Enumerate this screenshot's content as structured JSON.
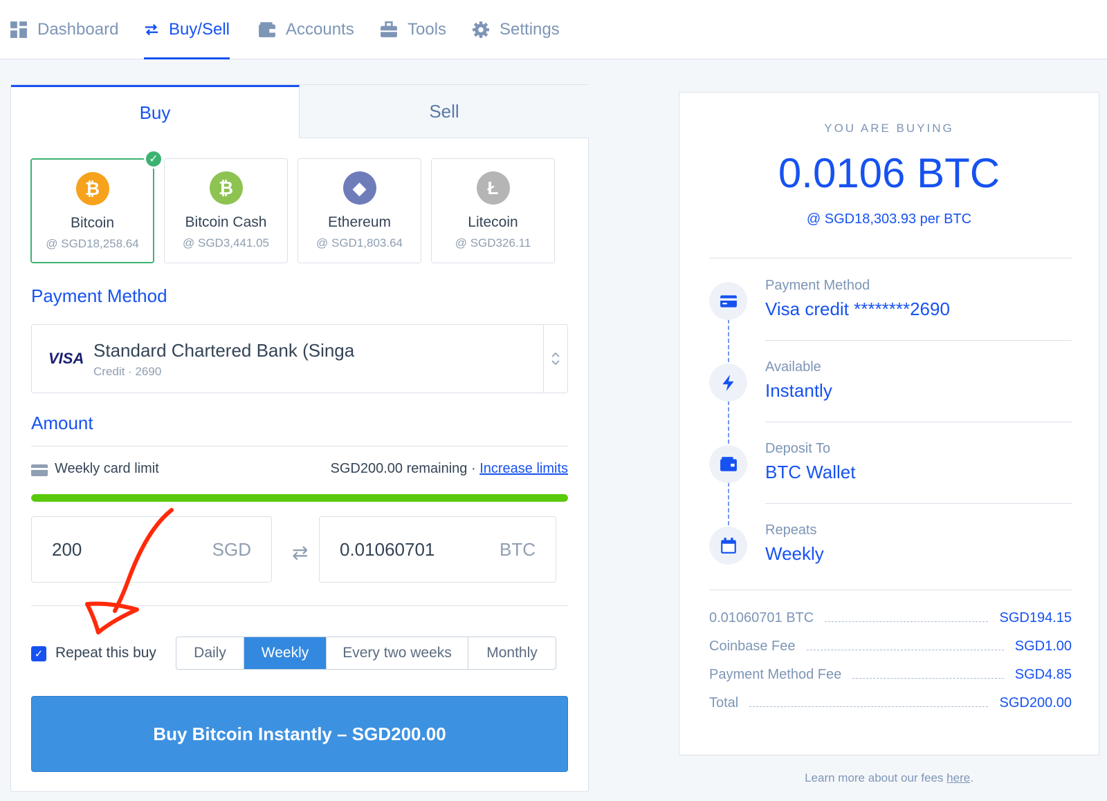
{
  "nav": {
    "items": [
      {
        "label": "Dashboard",
        "icon": "dashboard-icon"
      },
      {
        "label": "Buy/Sell",
        "icon": "swap-arrows-icon",
        "active": true
      },
      {
        "label": "Accounts",
        "icon": "wallet-icon"
      },
      {
        "label": "Tools",
        "icon": "toolbox-icon"
      },
      {
        "label": "Settings",
        "icon": "gear-icon"
      }
    ]
  },
  "tabs": {
    "buy": "Buy",
    "sell": "Sell"
  },
  "coins": [
    {
      "name": "Bitcoin",
      "price": "@ SGD18,258.64",
      "symbol": "₿",
      "color": "#f7a21c",
      "selected": true
    },
    {
      "name": "Bitcoin Cash",
      "price": "@ SGD3,441.05",
      "symbol": "₿",
      "color": "#8dc351"
    },
    {
      "name": "Ethereum",
      "price": "@ SGD1,803.64",
      "symbol": "◆",
      "color": "#6f7cba"
    },
    {
      "name": "Litecoin",
      "price": "@ SGD326.11",
      "symbol": "Ł",
      "color": "#b5b5b5"
    }
  ],
  "payment": {
    "title": "Payment Method",
    "brand": "VISA",
    "name": "Standard Chartered Bank (Singa",
    "sub": "Credit · 2690"
  },
  "amount": {
    "title": "Amount",
    "limit_label": "Weekly card limit",
    "limit_remaining": "SGD200.00 remaining",
    "separator": "·",
    "increase_link": "Increase limits",
    "limit_fraction": 1.0,
    "fiat_value": "200",
    "fiat_currency": "SGD",
    "crypto_value": "0.01060701",
    "crypto_currency": "BTC"
  },
  "repeat": {
    "label": "Repeat this buy",
    "checked": true,
    "options": [
      "Daily",
      "Weekly",
      "Every two weeks",
      "Monthly"
    ],
    "selected": "Weekly"
  },
  "buy_button": "Buy Bitcoin Instantly – SGD200.00",
  "receipt": {
    "eyebrow": "YOU ARE BUYING",
    "amount": "0.0106 BTC",
    "rate": "@ SGD18,303.93 per BTC",
    "items": [
      {
        "label": "Payment Method",
        "value": "Visa credit ********2690",
        "icon": "credit-card-icon"
      },
      {
        "label": "Available",
        "value": "Instantly",
        "icon": "lightning-icon"
      },
      {
        "label": "Deposit To",
        "value": "BTC Wallet",
        "icon": "wallet-icon"
      },
      {
        "label": "Repeats",
        "value": "Weekly",
        "icon": "calendar-icon"
      }
    ],
    "fees": [
      {
        "label": "0.01060701 BTC",
        "value": "SGD194.15"
      },
      {
        "label": "Coinbase Fee",
        "value": "SGD1.00"
      },
      {
        "label": "Payment Method Fee",
        "value": "SGD4.85"
      },
      {
        "label": "Total",
        "value": "SGD200.00"
      }
    ],
    "footer_text": "Learn more about our fees ",
    "footer_link": "here",
    "footer_end": "."
  },
  "colors": {
    "accent": "#1652f0",
    "button": "#3d91e1",
    "success": "#3cb371",
    "progress": "#5ac90c",
    "annotation": "#ff2a0a"
  }
}
